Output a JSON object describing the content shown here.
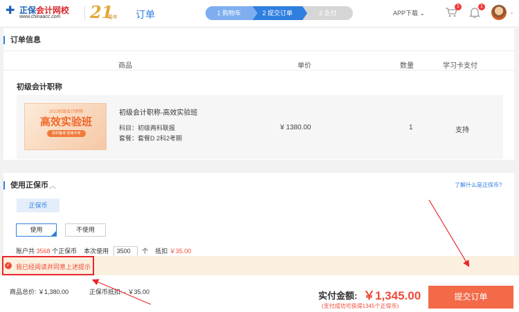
{
  "header": {
    "logo_brand_a": "正保",
    "logo_brand_b": "会计网校",
    "logo_url": "www.chinaacc.com",
    "anniv_num": "21",
    "anniv_suffix": "周年",
    "page_title": "订单",
    "steps": [
      "1 购物车",
      "2 提交订单",
      "3 支付"
    ],
    "app_download": "APP下载",
    "cart_badge": "1",
    "bell_badge": "1"
  },
  "order": {
    "title": "订单信息",
    "columns": [
      "商品",
      "单价",
      "数量",
      "学习卡支付"
    ],
    "course_name": "初级会计职称",
    "item": {
      "thumb_top": "2022初级会计职称",
      "thumb_main": "高效实验班",
      "thumb_tag": "新材备考 拒绝不考",
      "title": "初级会计职称-高效实验班",
      "subject": "科目：初级两科联报",
      "package": "套餐：套餐D 2科2考期",
      "price": "¥ 1380.00",
      "qty": "1",
      "card_pay": "支持"
    }
  },
  "coins": {
    "title": "使用正保币",
    "what_link": "了解什么是正保币?",
    "tab": "正保币",
    "use": "使用",
    "not_use": "不使用",
    "acc_prefix": "账户共",
    "acc_count": "3568",
    "acc_unit": "个正保币",
    "use_prefix": "本次使用",
    "use_value": "3500",
    "use_unit": "个",
    "deduct_label": "抵扣",
    "deduct_amount": "￥35.00"
  },
  "agree": {
    "text": "我已经阅读并同意上述提示"
  },
  "summary": {
    "total": "商品总价: ￥1,380.00",
    "coin_deduct": "正保币抵扣: - ￥35.00",
    "pay_label": "实付金额:",
    "pay_amount": "￥1,345.00",
    "pay_note": "(支付成功可获得1345个正保币)",
    "submit": "提交订单"
  },
  "colors": {
    "accent": "#2f7fe0",
    "danger": "#ef4a38",
    "submit": "#f26a48"
  }
}
